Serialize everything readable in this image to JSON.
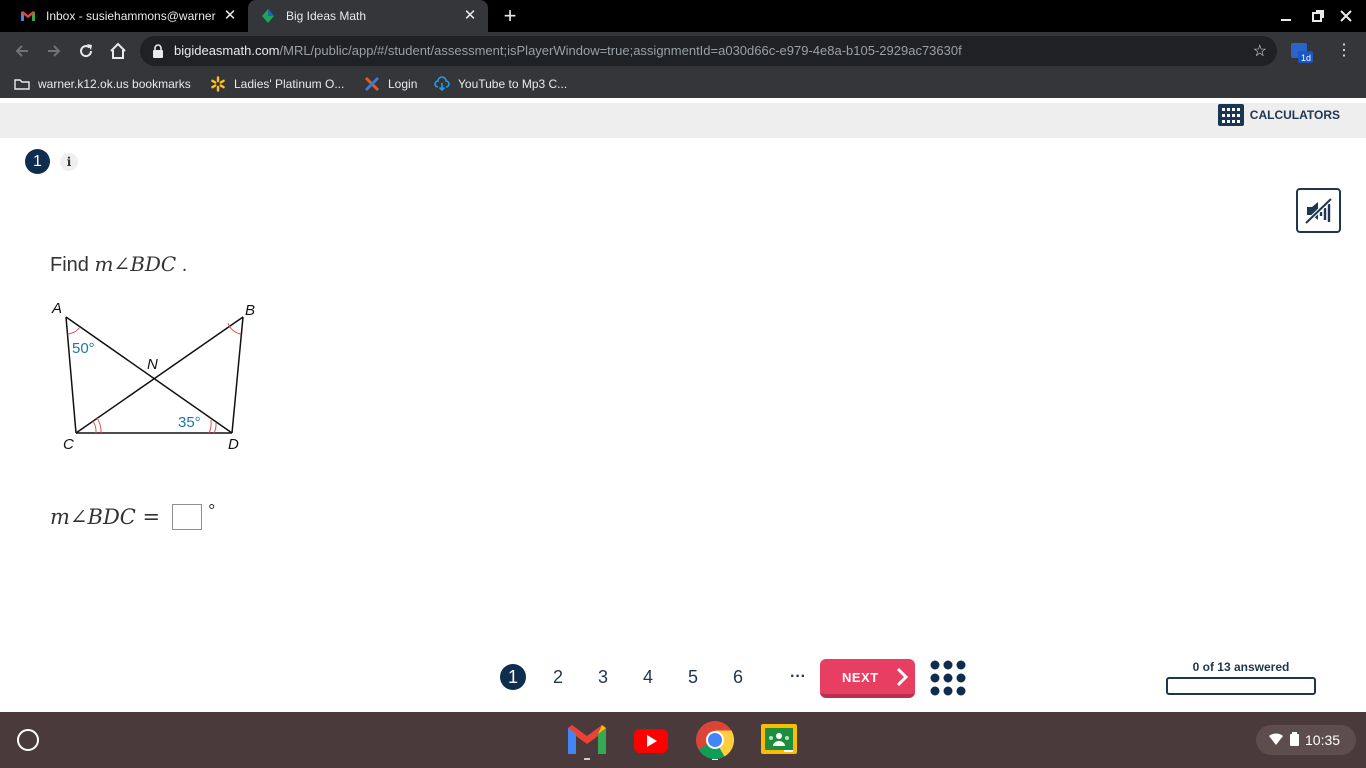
{
  "browser": {
    "tabs": [
      {
        "title": "Inbox - susiehammons@warner",
        "favicon": "gmail-icon"
      },
      {
        "title": "Big Ideas Math",
        "favicon": "big-ideas-math-icon",
        "active": true
      }
    ],
    "url_host": "bigideasmath.com",
    "url_path": "/MRL/public/app/#/student/assessment;isPlayerWindow=true;assignmentId=a030d66c-e979-4e8a-b105-2929ac73630f",
    "extension_badge": "1d",
    "bookmarks": [
      {
        "label": "warner.k12.ok.us bookmarks",
        "icon": "folder-icon"
      },
      {
        "label": "Ladies' Platinum O...",
        "icon": "walmart-spark-icon"
      },
      {
        "label": "Login",
        "icon": "x-logo-icon"
      },
      {
        "label": "YouTube to Mp3 C...",
        "icon": "cloud-download-icon"
      }
    ]
  },
  "app": {
    "calculators_label": "CALCULATORS",
    "question_number": "1",
    "info_label": "i",
    "prompt_prefix": "Find",
    "prompt_math": "m∠BDC",
    "prompt_suffix": ".",
    "figure": {
      "labels": {
        "A": "A",
        "B": "B",
        "C": "C",
        "D": "D",
        "N": "N"
      },
      "angle_A": "50°",
      "angle_D": "35°"
    },
    "answer_label": "m∠BDC =",
    "answer_value": "",
    "answer_unit": "°",
    "pages": [
      "1",
      "2",
      "3",
      "4",
      "5",
      "6"
    ],
    "current_page": "1",
    "more_label": "···",
    "next_label": "NEXT",
    "progress_text": "0 of 13 answered",
    "progress_fraction": 0
  },
  "os": {
    "time": "10:35",
    "shelf_apps": [
      "gmail-icon",
      "youtube-icon",
      "chrome-icon",
      "google-classroom-icon"
    ]
  },
  "colors": {
    "navy": "#0f2d4e",
    "next_pink": "#e83e62",
    "angle_blue": "#1a7aa6",
    "angle_red": "#e05050"
  }
}
